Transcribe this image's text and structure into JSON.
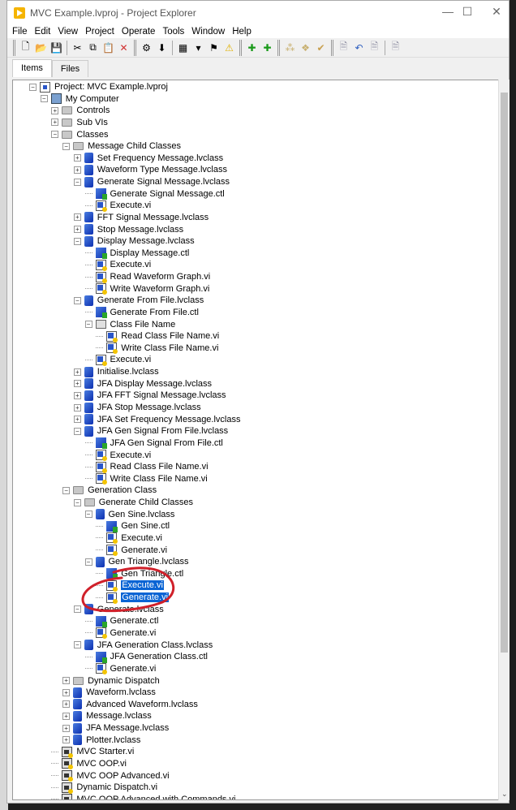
{
  "window": {
    "title": "MVC Example.lvproj - Project Explorer",
    "controls": [
      "minimize",
      "maximize",
      "close"
    ]
  },
  "menu": [
    "File",
    "Edit",
    "View",
    "Project",
    "Operate",
    "Tools",
    "Window",
    "Help"
  ],
  "toolbar": [
    {
      "icon": "grip"
    },
    {
      "icon": "new-icon",
      "g": "🗋"
    },
    {
      "icon": "open-icon",
      "g": "📂"
    },
    {
      "icon": "save-all-icon",
      "g": "💾"
    },
    {
      "icon": "sep"
    },
    {
      "icon": "cut-icon",
      "g": "✂"
    },
    {
      "icon": "copy-icon",
      "g": "⧉"
    },
    {
      "icon": "paste-icon",
      "g": "📋"
    },
    {
      "icon": "delete-icon",
      "g": "✕",
      "c": "#d03030"
    },
    {
      "icon": "grip"
    },
    {
      "icon": "build-icon",
      "g": "⚙"
    },
    {
      "icon": "deploy-icon",
      "g": "⬇"
    },
    {
      "icon": "sep"
    },
    {
      "icon": "window-icon",
      "g": "▦"
    },
    {
      "icon": "dropdown-icon",
      "g": "▾"
    },
    {
      "icon": "resolve-icon",
      "g": "⚑"
    },
    {
      "icon": "warning-icon",
      "g": "⚠",
      "c": "#e0b000"
    },
    {
      "icon": "grip"
    },
    {
      "icon": "add-icon",
      "g": "✚",
      "c": "#1a9a1a"
    },
    {
      "icon": "add-folder-icon",
      "g": "✚",
      "c": "#1a9a1a"
    },
    {
      "icon": "grip"
    },
    {
      "icon": "source-control-1-icon",
      "g": "⁂",
      "c": "#c8b070"
    },
    {
      "icon": "source-control-2-icon",
      "g": "❖",
      "c": "#c8b070"
    },
    {
      "icon": "source-control-3-icon",
      "g": "✔",
      "c": "#c8a050"
    },
    {
      "icon": "grip"
    },
    {
      "icon": "checkout-icon",
      "g": "🗎",
      "c": "#99a"
    },
    {
      "icon": "undo-checkout-icon",
      "g": "↶",
      "c": "#3060c0"
    },
    {
      "icon": "checkin-icon",
      "g": "🗎",
      "c": "#99a"
    },
    {
      "icon": "sep"
    },
    {
      "icon": "add-scc-icon",
      "g": "🗎",
      "c": "#99a"
    }
  ],
  "tabs": [
    {
      "label": "Items",
      "active": true
    },
    {
      "label": "Files",
      "active": false
    }
  ],
  "accent": "#0a64d4",
  "annotation_color": "#d0202a",
  "tree": [
    {
      "l": 0,
      "t": "project",
      "e": "-",
      "label": "Project: MVC Example.lvproj"
    },
    {
      "l": 1,
      "t": "computer",
      "e": "-",
      "label": "My Computer"
    },
    {
      "l": 2,
      "t": "folder",
      "e": "+",
      "label": "Controls"
    },
    {
      "l": 2,
      "t": "folder",
      "e": "+",
      "label": "Sub VIs"
    },
    {
      "l": 2,
      "t": "folder",
      "e": "-",
      "label": "Classes"
    },
    {
      "l": 3,
      "t": "folder",
      "e": "-",
      "label": "Message Child Classes"
    },
    {
      "l": 4,
      "t": "class",
      "e": "+",
      "label": "Set Frequency Message.lvclass"
    },
    {
      "l": 4,
      "t": "class",
      "e": "+",
      "label": "Waveform Type Message.lvclass"
    },
    {
      "l": 4,
      "t": "class",
      "e": "-",
      "label": "Generate Signal Message.lvclass"
    },
    {
      "l": 5,
      "t": "ctl",
      "label": "Generate Signal Message.ctl"
    },
    {
      "l": 5,
      "t": "vi",
      "label": "Execute.vi"
    },
    {
      "l": 4,
      "t": "class",
      "e": "+",
      "label": "FFT Signal Message.lvclass"
    },
    {
      "l": 4,
      "t": "class",
      "e": "+",
      "label": "Stop Message.lvclass"
    },
    {
      "l": 4,
      "t": "class",
      "e": "-",
      "label": "Display Message.lvclass"
    },
    {
      "l": 5,
      "t": "ctl",
      "label": "Display Message.ctl"
    },
    {
      "l": 5,
      "t": "vi",
      "label": "Execute.vi"
    },
    {
      "l": 5,
      "t": "vi",
      "label": "Read Waveform Graph.vi"
    },
    {
      "l": 5,
      "t": "vi",
      "label": "Write Waveform Graph.vi"
    },
    {
      "l": 4,
      "t": "class",
      "e": "-",
      "label": "Generate From File.lvclass"
    },
    {
      "l": 5,
      "t": "ctl",
      "label": "Generate From File.ctl"
    },
    {
      "l": 5,
      "t": "vfolder",
      "e": "-",
      "label": "Class File Name"
    },
    {
      "l": 6,
      "t": "vi",
      "label": "Read Class File Name.vi"
    },
    {
      "l": 6,
      "t": "vi",
      "label": "Write Class File Name.vi"
    },
    {
      "l": 5,
      "t": "vi",
      "label": "Execute.vi"
    },
    {
      "l": 4,
      "t": "class",
      "e": "+",
      "label": "Initialise.lvclass"
    },
    {
      "l": 4,
      "t": "class",
      "e": "+",
      "label": "JFA Display Message.lvclass"
    },
    {
      "l": 4,
      "t": "class",
      "e": "+",
      "label": "JFA FFT Signal Message.lvclass"
    },
    {
      "l": 4,
      "t": "class",
      "e": "+",
      "label": "JFA Stop Message.lvclass"
    },
    {
      "l": 4,
      "t": "class",
      "e": "+",
      "label": "JFA Set Frequency Message.lvclass"
    },
    {
      "l": 4,
      "t": "class",
      "e": "-",
      "label": "JFA Gen Signal From File.lvclass"
    },
    {
      "l": 5,
      "t": "ctl",
      "label": "JFA Gen Signal From File.ctl"
    },
    {
      "l": 5,
      "t": "vi",
      "label": "Execute.vi"
    },
    {
      "l": 5,
      "t": "vi",
      "label": "Read Class File Name.vi"
    },
    {
      "l": 5,
      "t": "vi",
      "label": "Write Class File Name.vi"
    },
    {
      "l": 3,
      "t": "folder",
      "e": "-",
      "label": "Generation Class"
    },
    {
      "l": 4,
      "t": "folder",
      "e": "-",
      "label": "Generate Child Classes"
    },
    {
      "l": 5,
      "t": "class",
      "e": "-",
      "label": "Gen Sine.lvclass"
    },
    {
      "l": 6,
      "t": "ctl",
      "label": "Gen Sine.ctl"
    },
    {
      "l": 6,
      "t": "vi",
      "label": "Execute.vi"
    },
    {
      "l": 6,
      "t": "vi",
      "label": "Generate.vi"
    },
    {
      "l": 5,
      "t": "class",
      "e": "-",
      "label": "Gen Triangle.lvclass"
    },
    {
      "l": 6,
      "t": "ctl",
      "label": "Gen Triangle.ctl"
    },
    {
      "l": 6,
      "t": "vi",
      "label": "Execute.vi",
      "selected": true
    },
    {
      "l": 6,
      "t": "vi",
      "label": "Generate.vi",
      "selected": true
    },
    {
      "l": 4,
      "t": "class",
      "e": "-",
      "label": "Generate.lvclass"
    },
    {
      "l": 5,
      "t": "ctl",
      "label": "Generate.ctl"
    },
    {
      "l": 5,
      "t": "vi",
      "label": "Generate.vi"
    },
    {
      "l": 4,
      "t": "class",
      "e": "-",
      "label": "JFA Generation Class.lvclass"
    },
    {
      "l": 5,
      "t": "ctl",
      "label": "JFA Generation Class.ctl"
    },
    {
      "l": 5,
      "t": "vi",
      "label": "Generate.vi"
    },
    {
      "l": 3,
      "t": "folder",
      "e": "+",
      "label": "Dynamic Dispatch"
    },
    {
      "l": 3,
      "t": "class",
      "e": "+",
      "label": "Waveform.lvclass"
    },
    {
      "l": 3,
      "t": "class",
      "e": "+",
      "label": "Advanced Waveform.lvclass"
    },
    {
      "l": 3,
      "t": "class",
      "e": "+",
      "label": "Message.lvclass"
    },
    {
      "l": 3,
      "t": "class",
      "e": "+",
      "label": "JFA Message.lvclass"
    },
    {
      "l": 3,
      "t": "class",
      "e": "+",
      "label": "Plotter.lvclass"
    },
    {
      "l": 2,
      "t": "topvi",
      "label": "MVC Starter.vi"
    },
    {
      "l": 2,
      "t": "topvi",
      "label": "MVC OOP.vi"
    },
    {
      "l": 2,
      "t": "topvi",
      "label": "MVC OOP Advanced.vi"
    },
    {
      "l": 2,
      "t": "topvi",
      "label": "Dynamic Dispatch.vi"
    },
    {
      "l": 2,
      "t": "topvi",
      "label": "MVC OOP Advanced with Commands.vi"
    }
  ]
}
